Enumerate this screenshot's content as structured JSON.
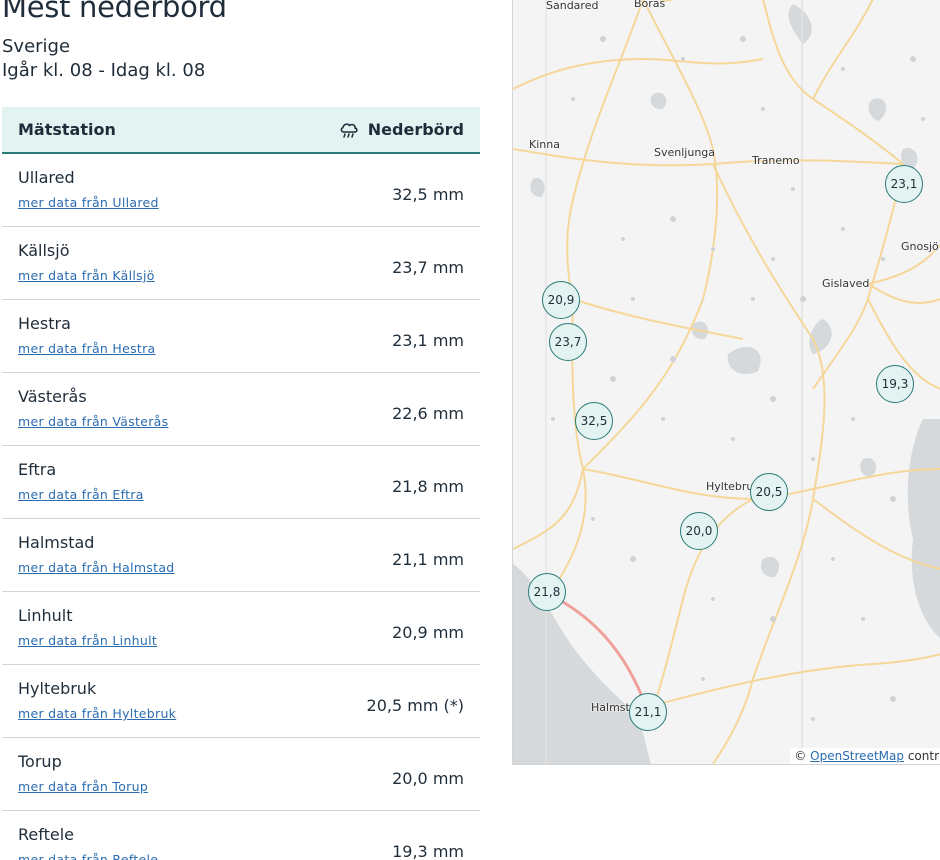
{
  "header": {
    "title": "Mest nederbörd",
    "region": "Sverige",
    "period": "Igår kl. 08 - Idag kl. 08"
  },
  "table": {
    "col_station": "Mätstation",
    "col_precip": "Nederbörd",
    "precip_icon": "rain-cloud-icon",
    "rows": [
      {
        "name": "Ullared",
        "link": "mer data från Ullared",
        "value": "32,5 mm"
      },
      {
        "name": "Källsjö",
        "link": "mer data från Källsjö",
        "value": "23,7 mm"
      },
      {
        "name": "Hestra",
        "link": "mer data från Hestra",
        "value": "23,1 mm"
      },
      {
        "name": "Västerås",
        "link": "mer data från Västerås",
        "value": "22,6 mm"
      },
      {
        "name": "Eftra",
        "link": "mer data från Eftra",
        "value": "21,8 mm"
      },
      {
        "name": "Halmstad",
        "link": "mer data från Halmstad",
        "value": "21,1 mm"
      },
      {
        "name": "Linhult",
        "link": "mer data från Linhult",
        "value": "20,9 mm"
      },
      {
        "name": "Hyltebruk",
        "link": "mer data från Hyltebruk",
        "value": "20,5 mm (*)"
      },
      {
        "name": "Torup",
        "link": "mer data från Torup",
        "value": "20,0 mm"
      },
      {
        "name": "Reftele",
        "link": "mer data från Reftele",
        "value": "19,3 mm"
      }
    ]
  },
  "map": {
    "places": [
      "Sandared",
      "Borås",
      "Kinna",
      "Svenljunga",
      "Tranemo",
      "Gnosjö",
      "Gislaved",
      "Hyltebruk",
      "Halmstad"
    ],
    "markers": [
      "23,1",
      "20,9",
      "23,7",
      "19,3",
      "32,5",
      "20,5",
      "20,0",
      "21,8",
      "21,1"
    ],
    "attribution_prefix": "©",
    "attribution_link": "OpenStreetMap",
    "attribution_suffix": "contr"
  }
}
